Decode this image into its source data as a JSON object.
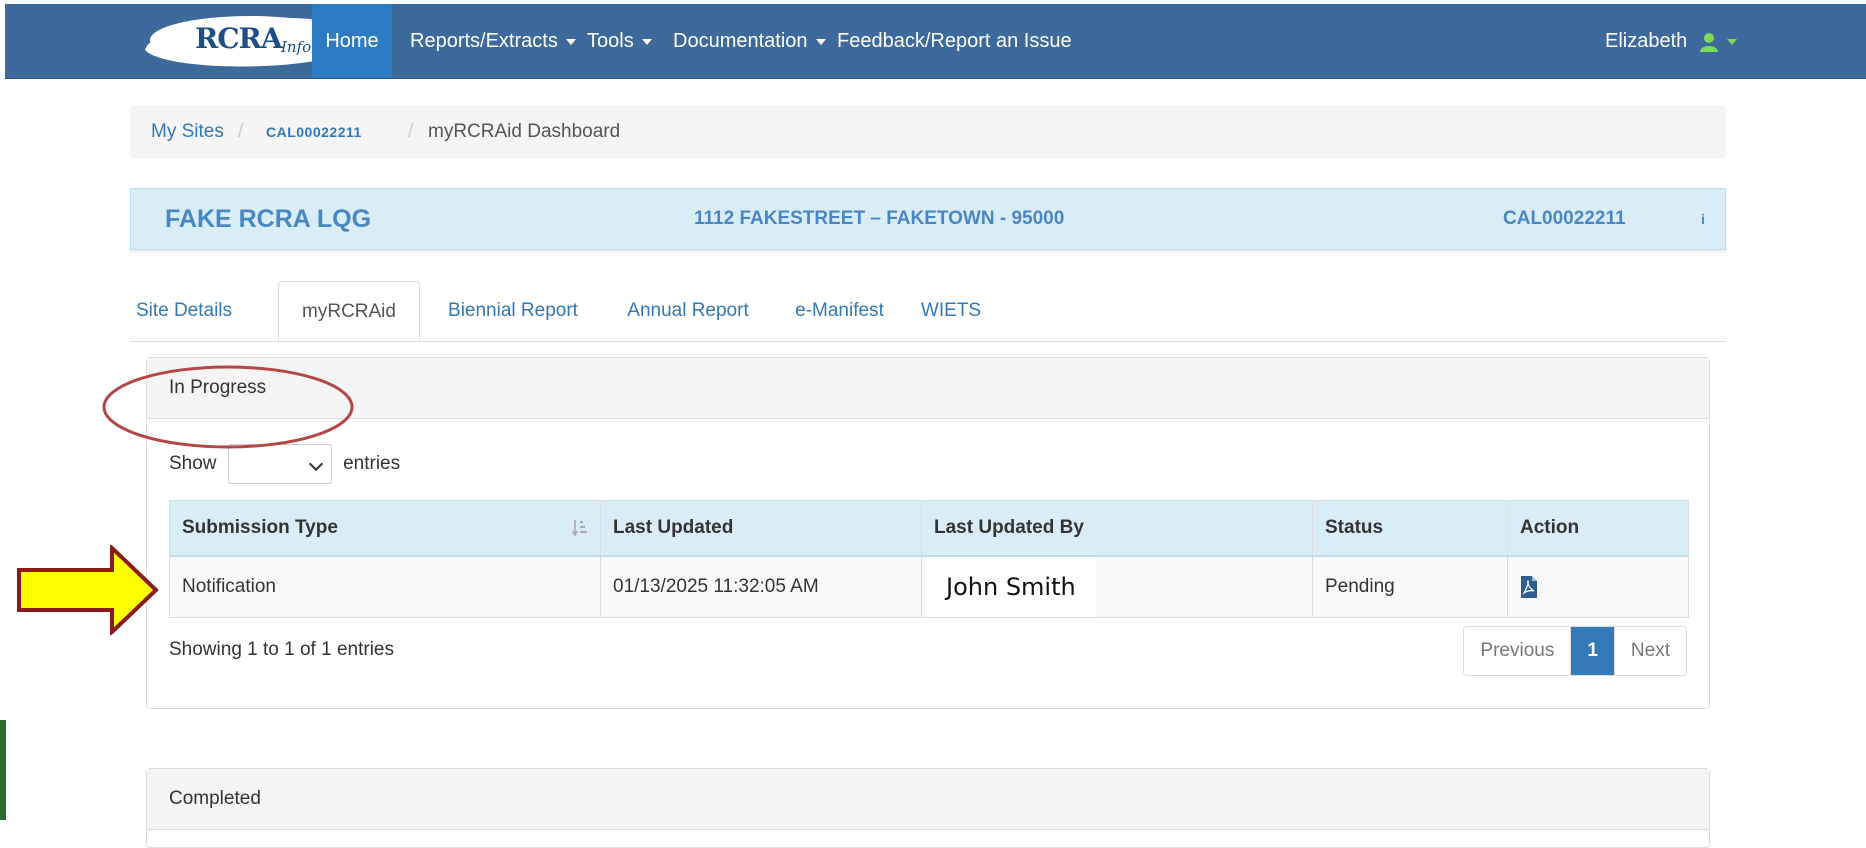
{
  "navbar": {
    "logo_text": "RCRA",
    "logo_sub": "Info",
    "items": [
      {
        "label": "Home",
        "active": true
      },
      {
        "label": "Reports/Extracts",
        "dropdown": true
      },
      {
        "label": "Tools",
        "dropdown": true
      },
      {
        "label": "Documentation",
        "dropdown": true
      },
      {
        "label": "Feedback/Report an Issue"
      }
    ],
    "user": {
      "name": "Elizabeth",
      "icon": "user-icon"
    }
  },
  "breadcrumb": {
    "items": [
      "My Sites",
      "CAL00022211",
      "myRCRAid Dashboard"
    ],
    "separator": "/"
  },
  "site": {
    "name": "FAKE RCRA LQG",
    "address": "1112 FAKESTREET – FAKETOWN - 95000",
    "id": "CAL00022211",
    "info_glyph": "i"
  },
  "tabs": [
    {
      "label": "Site Details"
    },
    {
      "label": "myRCRAid",
      "active": true
    },
    {
      "label": "Biennial Report"
    },
    {
      "label": "Annual Report"
    },
    {
      "label": "e-Manifest"
    },
    {
      "label": "WIETS"
    }
  ],
  "in_progress": {
    "heading": "In Progress",
    "show_label": "Show",
    "entries_label": "entries",
    "select_value": "",
    "columns": [
      "Submission Type",
      "Last Updated",
      "Last Updated By",
      "Status",
      "Action"
    ],
    "rows": [
      {
        "submission_type": "Notification",
        "last_updated": "01/13/2025 11:32:05 AM",
        "last_updated_by": "John Smith",
        "status": "Pending",
        "action_icon": "pdf-icon"
      }
    ],
    "showing_text": "Showing 1 to 1 of 1 entries",
    "pagination": {
      "previous": "Previous",
      "current": "1",
      "next": "Next"
    }
  },
  "completed": {
    "heading": "Completed"
  },
  "colors": {
    "navbar_bg": "#3d6a9a",
    "nav_active": "#2c7bc3",
    "link": "#3278b6",
    "banner_bg": "#d9edf7",
    "annotation_circle": "#b34747",
    "arrow_fill": "#ffff00",
    "arrow_stroke": "#8b1a1a"
  }
}
